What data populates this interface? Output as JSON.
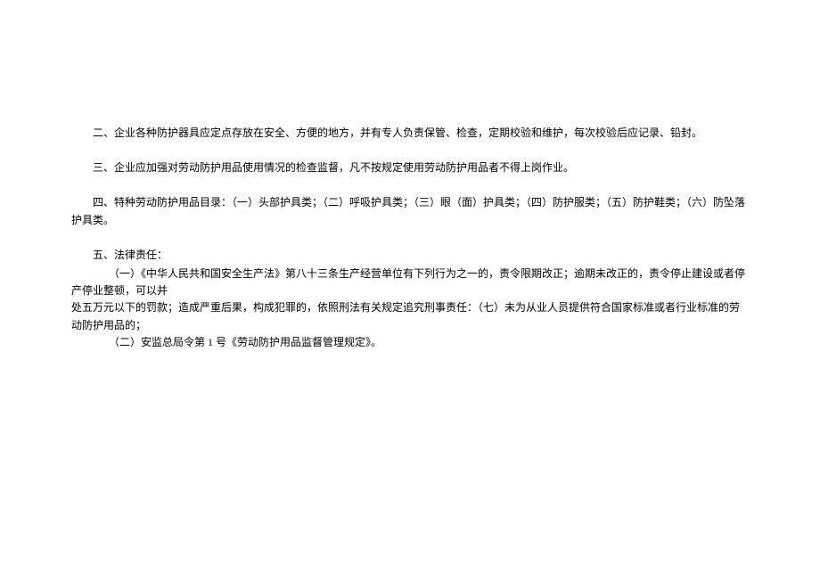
{
  "paragraphs": {
    "p2": "二、企业各种防护器具应定点存放在安全、方便的地方，并有专人负责保管、检查，定期校验和维护，每次校验后应记录、铅封。",
    "p3": "三、企业应加强对劳动防护用品使用情况的检查监督，凡不按规定使用劳动防护用品者不得上岗作业。",
    "p4": "四、特种劳动防护用品目录：（一）头部护具类；（二）呼吸护具类；（三）眼（面）护具类；（四）防护服类；（五）防护鞋类；（六）防坠落护具类。",
    "p5_line1": "五、法律责任：",
    "p5_sub1_a": "（一）《中华人民共和国安全生产法》第八十三条生产经营单位有下列行为之一的，责令限期改正；逾期未改正的，责令停止建设或者停产停业整顿，可以并",
    "p5_sub1_b": "处五万元以下的罚款；造成严重后果，构成犯罪的，依照刑法有关规定追究刑事责任：（七）未为从业人员提供符合国家标准或者行业标准的劳动防护用品的；",
    "p5_sub2": "（二）安监总局令第 1 号《劳动防护用品监督管理规定》。"
  }
}
